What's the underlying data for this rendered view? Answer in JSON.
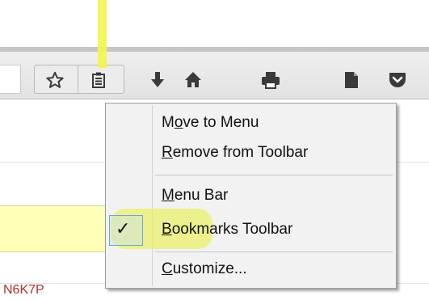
{
  "toolbar": {
    "buttons": [
      "star-icon",
      "bookmarks-menu-icon",
      "download-icon",
      "home-icon",
      "print-icon",
      "page-icon",
      "pocket-icon"
    ]
  },
  "context_menu": {
    "items": [
      {
        "label_pre": "M",
        "label_key": "o",
        "label_post": "ve to Menu"
      },
      {
        "label_pre": "",
        "label_key": "R",
        "label_post": "emove from Toolbar"
      },
      {
        "label_pre": "",
        "label_key": "M",
        "label_post": "enu Bar"
      },
      {
        "label_pre": "",
        "label_key": "B",
        "label_post": "ookmarks Toolbar",
        "checked": true
      },
      {
        "label_pre": "",
        "label_key": "C",
        "label_post": "ustomize..."
      }
    ]
  },
  "background_text": "N6K7P",
  "colors": {
    "highlight": "#f4f44a",
    "toolbar": "#e8e8e8",
    "menu": "#f2f2f2"
  }
}
